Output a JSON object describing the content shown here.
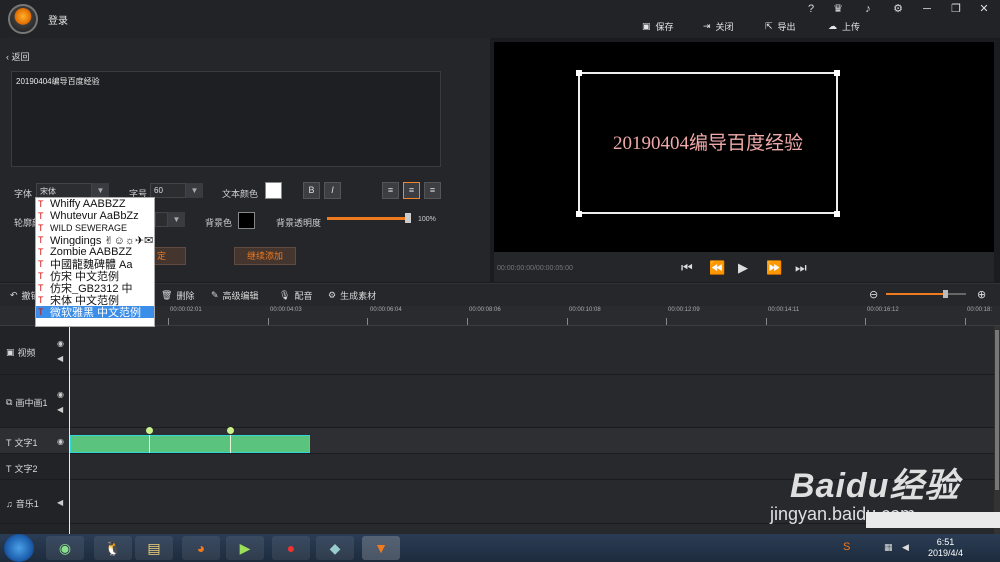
{
  "app": {
    "login": "登录",
    "window_buttons": [
      "?",
      "♛",
      "🔔",
      "⚙",
      "─",
      "❐",
      "✕"
    ],
    "toolbar": {
      "save": "保存",
      "close": "关闭",
      "export": "导出",
      "upload": "上传"
    }
  },
  "editor": {
    "back": "返回",
    "text_value": "20190404编导百度经验",
    "font_label": "字体",
    "font_value": "宋体",
    "size_label": "字号",
    "size_value": "60",
    "color_label": "文本颜色",
    "bold": "B",
    "italic": "I",
    "outline_label": "轮廓颜",
    "bg_label": "背景色",
    "opacity_label": "背景透明度",
    "opacity_value": "100%",
    "opacity_fraction": 1.0,
    "add_button": "继续添加",
    "confirm_button": "定"
  },
  "font_dropdown": {
    "items": [
      "Whiffy  AABBZZ",
      "Whutevur  AaBbZz",
      "WILD SEWERAGE",
      "Wingdings  ✌☺☼✈✉",
      "Zombie  AABBZZ",
      "中國龍魏碑體  Aa",
      "仿宋  中文范例",
      "仿宋_GB2312  中",
      "宋体  中文范例",
      "微软雅黑  中文范例"
    ],
    "selected_index": 9
  },
  "preview": {
    "text": "20190404编导百度经验",
    "timecode": "00:00:00:00/00:00:05:00",
    "controls": [
      "⏮",
      "⏪",
      "▶",
      "⏩",
      "⏭"
    ]
  },
  "timeline": {
    "tools": [
      "删除",
      "高级编辑",
      "配音",
      "生成素材"
    ],
    "hidden_tool": "撤销",
    "ruler": [
      "00:00:02:01",
      "00:00:04:03",
      "00:00:06:04",
      "00:00:08:06",
      "00:00:10:08",
      "00:00:12:09",
      "00:00:14:11",
      "00:00:16:12",
      "00:00:18:"
    ],
    "tracks": [
      "视频",
      "画中画1",
      "文字1",
      "文字2",
      "音乐1"
    ],
    "zoom_level": 0.75
  },
  "taskbar": {
    "time": "6:51",
    "date": "2019/4/4"
  },
  "watermark": {
    "logo": "Baidu经验",
    "url": "jingyan.baidu.com"
  },
  "colors": {
    "accent": "#f07a1e",
    "clip": "#5ac47f",
    "clip_border": "#2ed6d6",
    "preview_text": "#f0a9a9"
  }
}
